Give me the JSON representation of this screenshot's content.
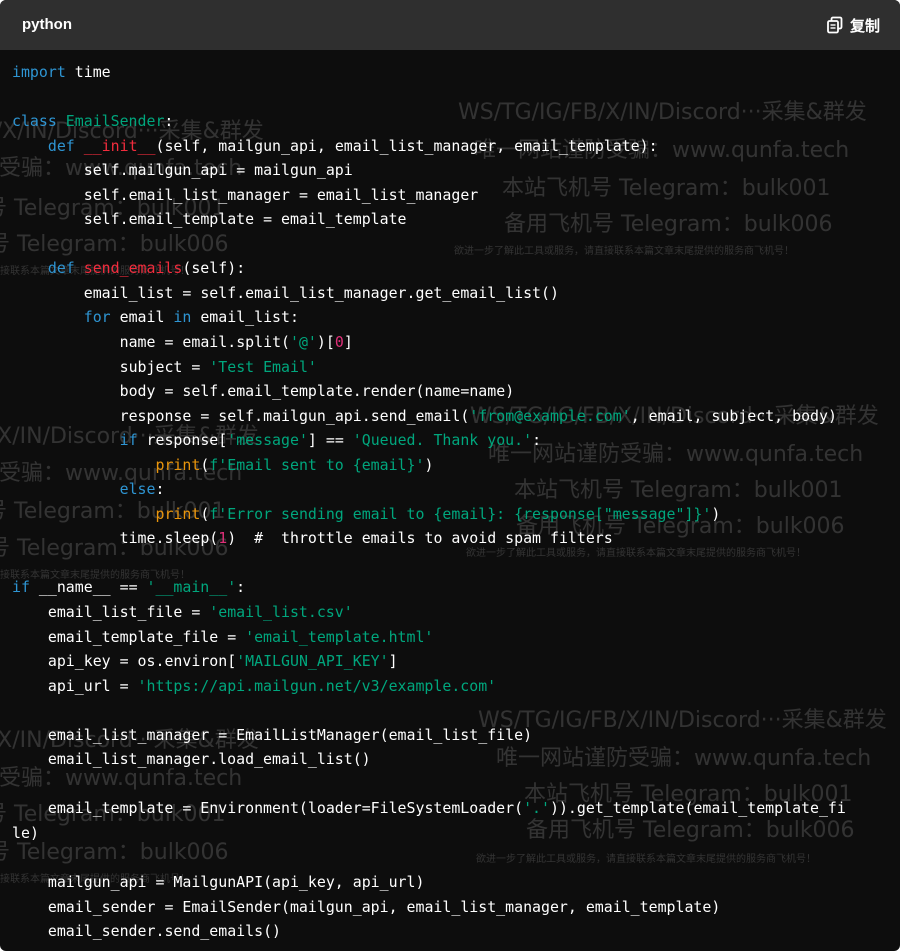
{
  "header": {
    "language": "python",
    "copy_label": "复制",
    "copy_icon": "copy-icon"
  },
  "colors": {
    "background": "#0d0d0d",
    "header_background": "#2f2f2f",
    "keyword": "#2e95d3",
    "function_name": "#f22c3d",
    "string": "#00a67d",
    "number": "#df3079",
    "builtin": "#e9950c"
  },
  "watermark": {
    "line1": "WS/TG/IG/FB/X/IN/Discord···采集&群发",
    "line2": "唯一网站谨防受骗：www.qunfa.tech",
    "line3": "本站飞机号 Telegram：bulk001",
    "line4": "备用飞机号 Telegram：bulk006",
    "line5": "欲进一步了解此工具或服务，请直接联系本篇文章末尾提供的服务商飞机号！"
  },
  "code": {
    "lines": [
      "import time",
      "",
      "class EmailSender:",
      "    def __init__(self, mailgun_api, email_list_manager, email_template):",
      "        self.mailgun_api = mailgun_api",
      "        self.email_list_manager = email_list_manager",
      "        self.email_template = email_template",
      "",
      "    def send_emails(self):",
      "        email_list = self.email_list_manager.get_email_list()",
      "        for email in email_list:",
      "            name = email.split('@')[0]",
      "            subject = 'Test Email'",
      "            body = self.email_template.render(name=name)",
      "            response = self.mailgun_api.send_email('from@example.com', email, subject, body)",
      "            if response['message'] == 'Queued. Thank you.':",
      "                print(f'Email sent to {email}')",
      "            else:",
      "                print(f'Error sending email to {email}: {response[\"message\"]}')",
      "            time.sleep(1)  #  throttle emails to avoid spam filters",
      "",
      "if __name__ == '__main__':",
      "    email_list_file = 'email_list.csv'",
      "    email_template_file = 'email_template.html'",
      "    api_key = os.environ['MAILGUN_API_KEY']",
      "    api_url = 'https://api.mailgun.net/v3/example.com'",
      "",
      "    email_list_manager = EmailListManager(email_list_file)",
      "    email_list_manager.load_email_list()",
      "",
      "    email_template = Environment(loader=FileSystemLoader('.')).get_template(email_template_fi",
      "le)",
      "",
      "    mailgun_api = MailgunAPI(api_key, api_url)",
      "    email_sender = EmailSender(mailgun_api, email_list_manager, email_template)",
      "    email_sender.send_emails()"
    ]
  }
}
